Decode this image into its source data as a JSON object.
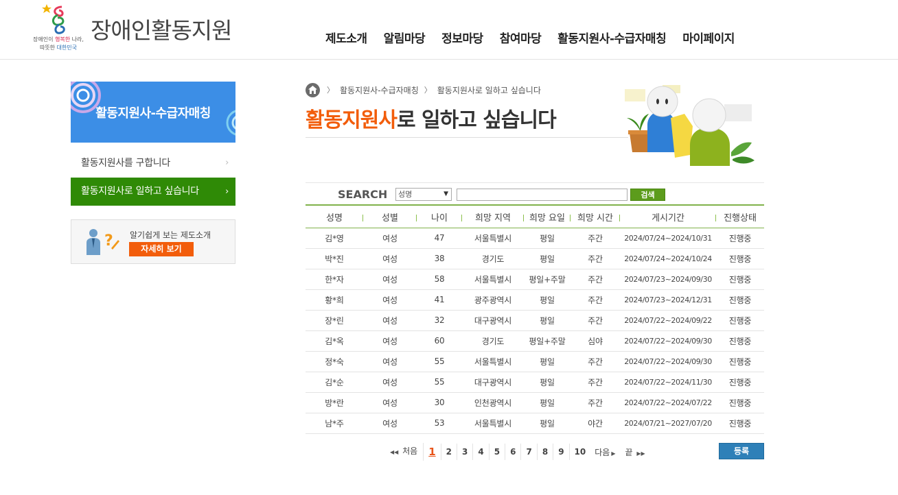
{
  "header": {
    "logo_title": "장애인활동지원",
    "slogan_line1_a": "장애인이 ",
    "slogan_line1_b": "행복한",
    "slogan_line1_c": " 나라,",
    "slogan_line2_a": "따뜻한 ",
    "slogan_line2_b": "대한민국",
    "nav": [
      "제도소개",
      "알림마당",
      "정보마당",
      "참여마당",
      "활동지원사-수급자매칭",
      "마이페이지"
    ]
  },
  "sidebar": {
    "banner_title": "활동지원사-수급자매칭",
    "items": [
      {
        "label": "활동지원사를 구합니다",
        "active": false
      },
      {
        "label": "활동지원사로 일하고 싶습니다",
        "active": true
      }
    ],
    "info_text": "알기쉽게 보는 제도소개",
    "info_button": "자세히 보기"
  },
  "breadcrumb": [
    "활동지원사-수급자매칭",
    "활동지원사로 일하고 싶습니다"
  ],
  "title": {
    "accent": "활동지원사",
    "rest": "로 일하고 싶습니다"
  },
  "search": {
    "label": "SEARCH",
    "selected_option": "성명",
    "input_value": "",
    "button": "검색"
  },
  "table": {
    "headers": [
      "성명",
      "성별",
      "나이",
      "희망 지역",
      "희망 요일",
      "희망 시간",
      "게시기간",
      "진행상태"
    ],
    "rows": [
      [
        "김*영",
        "여성",
        "47",
        "서울특별시",
        "평일",
        "주간",
        "2024/07/24~2024/10/31",
        "진행중"
      ],
      [
        "박*진",
        "여성",
        "38",
        "경기도",
        "평일",
        "주간",
        "2024/07/24~2024/10/24",
        "진행중"
      ],
      [
        "한*자",
        "여성",
        "58",
        "서울특별시",
        "평일+주말",
        "주간",
        "2024/07/23~2024/09/30",
        "진행중"
      ],
      [
        "황*희",
        "여성",
        "41",
        "광주광역시",
        "평일",
        "주간",
        "2024/07/23~2024/12/31",
        "진행중"
      ],
      [
        "장*린",
        "여성",
        "32",
        "대구광역시",
        "평일",
        "주간",
        "2024/07/22~2024/09/22",
        "진행중"
      ],
      [
        "김*옥",
        "여성",
        "60",
        "경기도",
        "평일+주말",
        "심야",
        "2024/07/22~2024/09/30",
        "진행중"
      ],
      [
        "정*숙",
        "여성",
        "55",
        "서울특별시",
        "평일",
        "주간",
        "2024/07/22~2024/09/30",
        "진행중"
      ],
      [
        "김*순",
        "여성",
        "55",
        "대구광역시",
        "평일",
        "주간",
        "2024/07/22~2024/11/30",
        "진행중"
      ],
      [
        "방*란",
        "여성",
        "30",
        "인천광역시",
        "평일",
        "주간",
        "2024/07/22~2024/07/22",
        "진행중"
      ],
      [
        "남*주",
        "여성",
        "53",
        "서울특별시",
        "평일",
        "야간",
        "2024/07/21~2027/07/20",
        "진행중"
      ]
    ]
  },
  "pagination": {
    "first": "처음",
    "pages": [
      "1",
      "2",
      "3",
      "4",
      "5",
      "6",
      "7",
      "8",
      "9",
      "10"
    ],
    "current": "1",
    "next": "다음",
    "last": "끝"
  },
  "register_button": "등록",
  "colors": {
    "accent_orange": "#f25d0b",
    "menu_green": "#2f8a06",
    "banner_blue": "#3c8ee6",
    "search_green": "#5c9c1c",
    "register_blue": "#2e80b8"
  }
}
